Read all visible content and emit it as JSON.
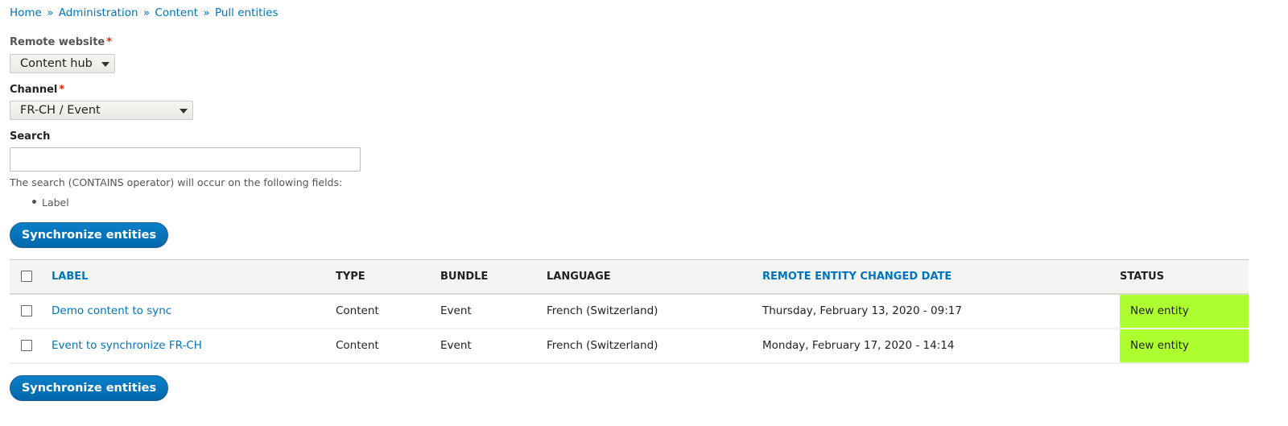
{
  "breadcrumb": [
    "Home",
    "Administration",
    "Content",
    "Pull entities"
  ],
  "breadcrumb_separator": "»",
  "form": {
    "remote_website": {
      "label": "Remote website",
      "required_mark": "*",
      "value": "Content hub"
    },
    "channel": {
      "label": "Channel",
      "required_mark": "*",
      "value": "FR-CH / Event"
    },
    "search": {
      "label": "Search",
      "value": "",
      "description": "The search (CONTAINS operator) will occur on the following fields:",
      "fields": [
        "Label"
      ]
    },
    "submit_label": "Synchronize entities"
  },
  "table": {
    "headers": [
      "LABEL",
      "TYPE",
      "BUNDLE",
      "LANGUAGE",
      "REMOTE ENTITY CHANGED DATE",
      "STATUS"
    ],
    "rows": [
      {
        "label": "Demo content to sync",
        "type": "Content",
        "bundle": "Event",
        "language": "French (Switzerland)",
        "changed": "Thursday, February 13, 2020 - 09:17",
        "status": "New entity"
      },
      {
        "label": "Event to synchronize FR-CH",
        "type": "Content",
        "bundle": "Event",
        "language": "French (Switzerland)",
        "changed": "Monday, February 17, 2020 - 14:14",
        "status": "New entity"
      }
    ]
  },
  "colors": {
    "link": "#0074bd",
    "button": "#0071b8",
    "status_new": "#adff2f",
    "required": "#e62600"
  }
}
